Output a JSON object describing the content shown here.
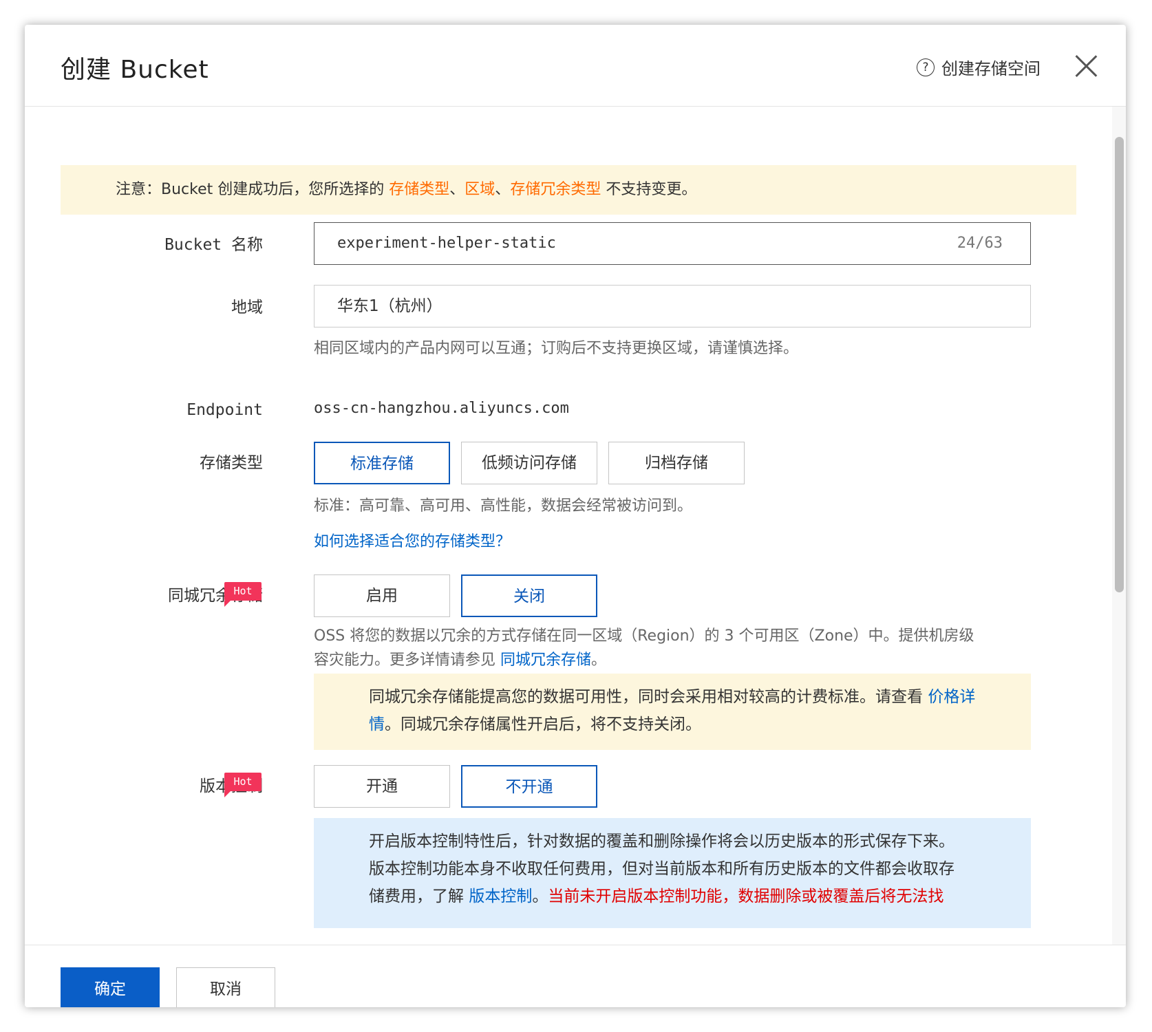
{
  "dialog": {
    "title": "创建 Bucket",
    "help_label": "创建存储空间",
    "help_icon": "?",
    "warning": {
      "prefix": "注意：Bucket 创建成功后，您所选择的 ",
      "hl1": "存储类型",
      "sep1": "、",
      "hl2": "区域",
      "sep2": "、",
      "hl3": "存储冗余类型",
      "suffix": " 不支持变更。"
    },
    "bucket_name": {
      "label": "Bucket 名称",
      "value": "experiment-helper-static",
      "count": "24/63"
    },
    "region": {
      "label": "地域",
      "value": "华东1（杭州）",
      "hint": "相同区域内的产品内网可以互通；订购后不支持更换区域，请谨慎选择。"
    },
    "endpoint": {
      "label": "Endpoint",
      "value": "oss-cn-hangzhou.aliyuncs.com"
    },
    "storage_class": {
      "label": "存储类型",
      "options": [
        "标准存储",
        "低频访问存储",
        "归档存储"
      ],
      "selected": "标准存储",
      "hint": "标准：高可靠、高可用、高性能，数据会经常被访问到。",
      "link": "如何选择适合您的存储类型？"
    },
    "zrs": {
      "label": "同城冗余存储",
      "badge": "Hot",
      "options": [
        "启用",
        "关闭"
      ],
      "selected": "关闭",
      "hint_line1": "OSS 将您的数据以冗余的方式存储在同一区域（Region）的 3 个可用区（Zone）中。提供机房级",
      "hint_line2_prefix": "容灾能力。更多详情请参见 ",
      "hint_link": "同城冗余存储",
      "hint_line2_suffix": "。",
      "notice_text": "同城冗余存储能提高您的数据可用性，同时会采用相对较高的计费标准。请查看 ",
      "notice_link": "价格详情",
      "notice_suffix": "。同城冗余存储属性开启后，将不支持关闭。"
    },
    "versioning": {
      "label": "版本控制",
      "badge": "Hot",
      "options": [
        "开通",
        "不开通"
      ],
      "selected": "不开通",
      "info_line1": "开启版本控制特性后，针对数据的覆盖和删除操作将会以历史版本的形式保存下来。",
      "info_line2": "版本控制功能本身不收取任何费用，但对当前版本和所有历史版本的文件都会收取存",
      "info_line3_prefix": "储费用，了解 ",
      "info_link": "版本控制",
      "info_line3_mid": "。",
      "info_warning": "当前未开启版本控制功能，数据删除或被覆盖后将无法找"
    },
    "footer": {
      "confirm": "确定",
      "cancel": "取消"
    }
  }
}
